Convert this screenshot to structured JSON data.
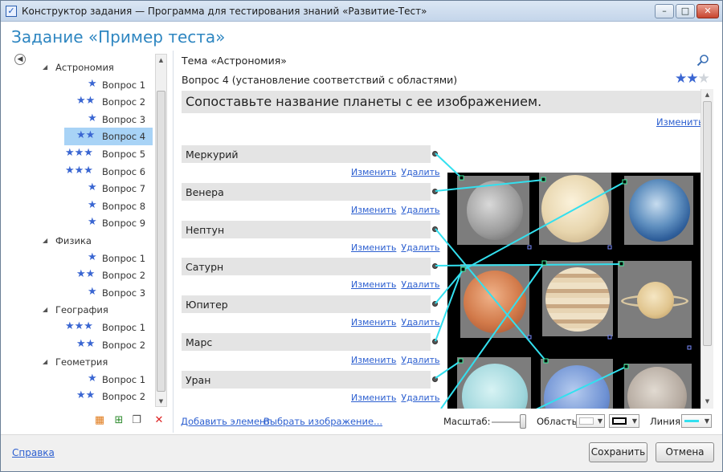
{
  "window": {
    "title": "Конструктор задания — Программа для тестирования знаний «Развитие-Тест»",
    "controls": [
      "–",
      "□",
      "✕"
    ]
  },
  "page_title": "Задание «Пример теста»",
  "tree": {
    "rows": [
      {
        "kind": "category",
        "label": "Астрономия"
      },
      {
        "kind": "question",
        "label": "Вопрос 1",
        "stars": 1
      },
      {
        "kind": "question",
        "label": "Вопрос 2",
        "stars": 2
      },
      {
        "kind": "question",
        "label": "Вопрос 3",
        "stars": 1
      },
      {
        "kind": "question",
        "label": "Вопрос 4",
        "stars": 2,
        "selected": true
      },
      {
        "kind": "question",
        "label": "Вопрос 5",
        "stars": 3
      },
      {
        "kind": "question",
        "label": "Вопрос 6",
        "stars": 3
      },
      {
        "kind": "question",
        "label": "Вопрос 7",
        "stars": 1
      },
      {
        "kind": "question",
        "label": "Вопрос 8",
        "stars": 1
      },
      {
        "kind": "question",
        "label": "Вопрос 9",
        "stars": 1
      },
      {
        "kind": "category",
        "label": "Физика"
      },
      {
        "kind": "question",
        "label": "Вопрос 1",
        "stars": 1
      },
      {
        "kind": "question",
        "label": "Вопрос 2",
        "stars": 2
      },
      {
        "kind": "question",
        "label": "Вопрос 3",
        "stars": 1
      },
      {
        "kind": "category",
        "label": "География"
      },
      {
        "kind": "question",
        "label": "Вопрос 1",
        "stars": 3
      },
      {
        "kind": "question",
        "label": "Вопрос 2",
        "stars": 2
      },
      {
        "kind": "category",
        "label": "Геометрия"
      },
      {
        "kind": "question",
        "label": "Вопрос 1",
        "stars": 1
      },
      {
        "kind": "question",
        "label": "Вопрос 2",
        "stars": 2
      }
    ]
  },
  "header": {
    "theme": "Тема «Астрономия»",
    "question_title": "Вопрос 4 (установление соответствий с областями)",
    "difficulty": 2,
    "difficulty_max": 3
  },
  "question": {
    "text": "Сопоставьте название планеты с ее изображением.",
    "edit_label": "Изменить"
  },
  "items": [
    {
      "label": "Меркурий"
    },
    {
      "label": "Венера"
    },
    {
      "label": "Нептун"
    },
    {
      "label": "Сатурн"
    },
    {
      "label": "Юпитер"
    },
    {
      "label": "Марс"
    },
    {
      "label": "Уран"
    }
  ],
  "item_links": {
    "edit": "Изменить",
    "delete": "Удалить"
  },
  "bottom": {
    "add_element": "Добавить элемент",
    "choose_image": "Выбрать изображение...",
    "scale_label": "Масштаб:",
    "area_label": "Область:",
    "line_label": "Линия:",
    "line_color": "#33e0ef"
  },
  "footer": {
    "help": "Справка",
    "save": "Сохранить",
    "cancel": "Отмена"
  },
  "colors": {
    "accent_title": "#2e86c1",
    "star": "#3a66d2",
    "link": "#2c5fd0",
    "selection": "#a8d3f6"
  }
}
